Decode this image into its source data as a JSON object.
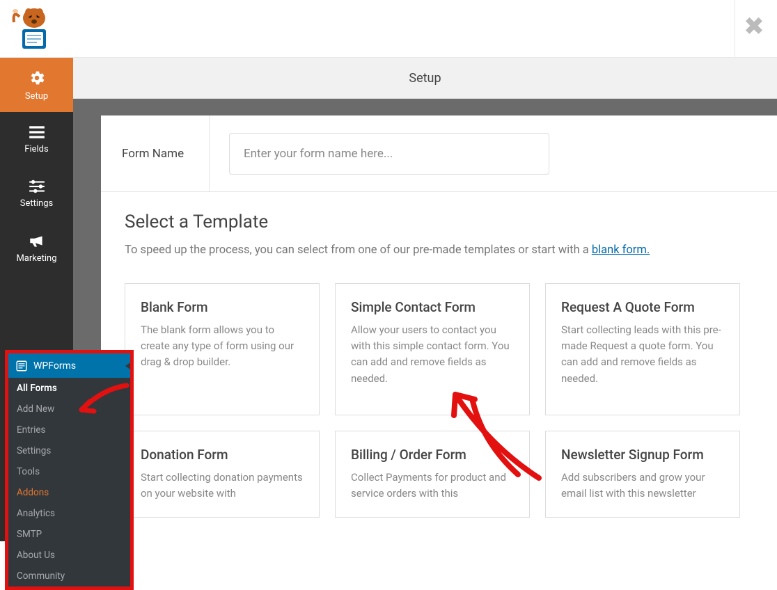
{
  "header": {
    "page_title": "Setup"
  },
  "sidebar": {
    "items": [
      {
        "label": "Setup",
        "icon": "gear",
        "active": true
      },
      {
        "label": "Fields",
        "icon": "list",
        "active": false
      },
      {
        "label": "Settings",
        "icon": "sliders",
        "active": false
      },
      {
        "label": "Marketing",
        "icon": "bullhorn",
        "active": false
      }
    ]
  },
  "form_name": {
    "label": "Form Name",
    "placeholder": "Enter your form name here..."
  },
  "templates": {
    "heading": "Select a Template",
    "subtext_prefix": "To speed up the process, you can select from one of our pre-made templates or start with a ",
    "subtext_link": "blank form.",
    "cards": [
      {
        "title": "Blank Form",
        "desc": "The blank form allows you to create any type of form using our drag & drop builder."
      },
      {
        "title": "Simple Contact Form",
        "desc": "Allow your users to contact you with this simple contact form. You can add and remove fields as needed."
      },
      {
        "title": "Request A Quote Form",
        "desc": "Start collecting leads with this pre-made Request a quote form. You can add and remove fields as needed."
      },
      {
        "title": "Donation Form",
        "desc": "Start collecting donation payments on your website with"
      },
      {
        "title": "Billing / Order Form",
        "desc": "Collect Payments for product and service orders with this"
      },
      {
        "title": "Newsletter Signup Form",
        "desc": "Add subscribers and grow your email list with this newsletter"
      }
    ]
  },
  "wp_submenu": {
    "header": "WPForms",
    "items": [
      {
        "label": "All Forms",
        "style": "bold"
      },
      {
        "label": "Add New",
        "style": ""
      },
      {
        "label": "Entries",
        "style": ""
      },
      {
        "label": "Settings",
        "style": ""
      },
      {
        "label": "Tools",
        "style": ""
      },
      {
        "label": "Addons",
        "style": "orange"
      },
      {
        "label": "Analytics",
        "style": ""
      },
      {
        "label": "SMTP",
        "style": ""
      },
      {
        "label": "About Us",
        "style": ""
      },
      {
        "label": "Community",
        "style": ""
      }
    ]
  }
}
